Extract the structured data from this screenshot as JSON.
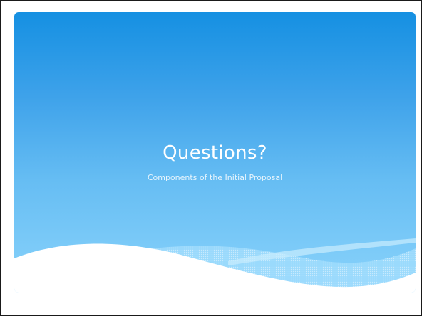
{
  "slide": {
    "title": "Questions?",
    "subtitle": "Components of the Initial Proposal"
  },
  "colors": {
    "gradient_top": "#1590e2",
    "gradient_bottom": "#8ad3fb",
    "text": "#ffffff",
    "frame_border": "#1a1a1a"
  }
}
